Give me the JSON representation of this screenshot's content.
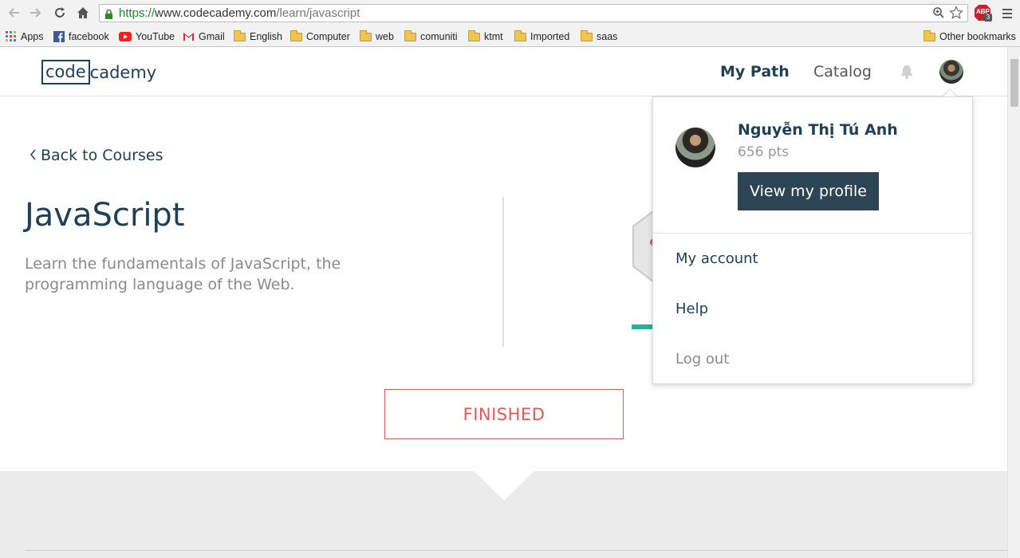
{
  "browser": {
    "url_scheme": "https://",
    "url_host": "www.codecademy.com",
    "url_path": "/learn/javascript",
    "bookmarks": [
      "Apps",
      "facebook",
      "YouTube",
      "Gmail",
      "English",
      "Computer",
      "web",
      "comuniti",
      "ktmt",
      "Imported",
      "saas"
    ],
    "other_bookmarks": "Other bookmarks",
    "abp_label": "ABP",
    "abp_count": "3"
  },
  "header": {
    "logo_box": "code",
    "logo_rest": "cademy",
    "nav_mypath": "My Path",
    "nav_catalog": "Catalog"
  },
  "course": {
    "back_label": "Back to Courses",
    "title": "JavaScript",
    "description": "Learn the fundamentals of JavaScript, the programming language of the Web.",
    "status": "FINISHED"
  },
  "dropdown": {
    "name": "Nguyễn Thị Tú Anh",
    "points": "656 pts",
    "view_profile": "View my profile",
    "items": [
      "My account",
      "Help",
      "Log out"
    ]
  },
  "colors": {
    "brand": "#204056",
    "finished": "#e05a5a",
    "progress": "#2ab0a0",
    "profile_button": "#2d4455"
  }
}
